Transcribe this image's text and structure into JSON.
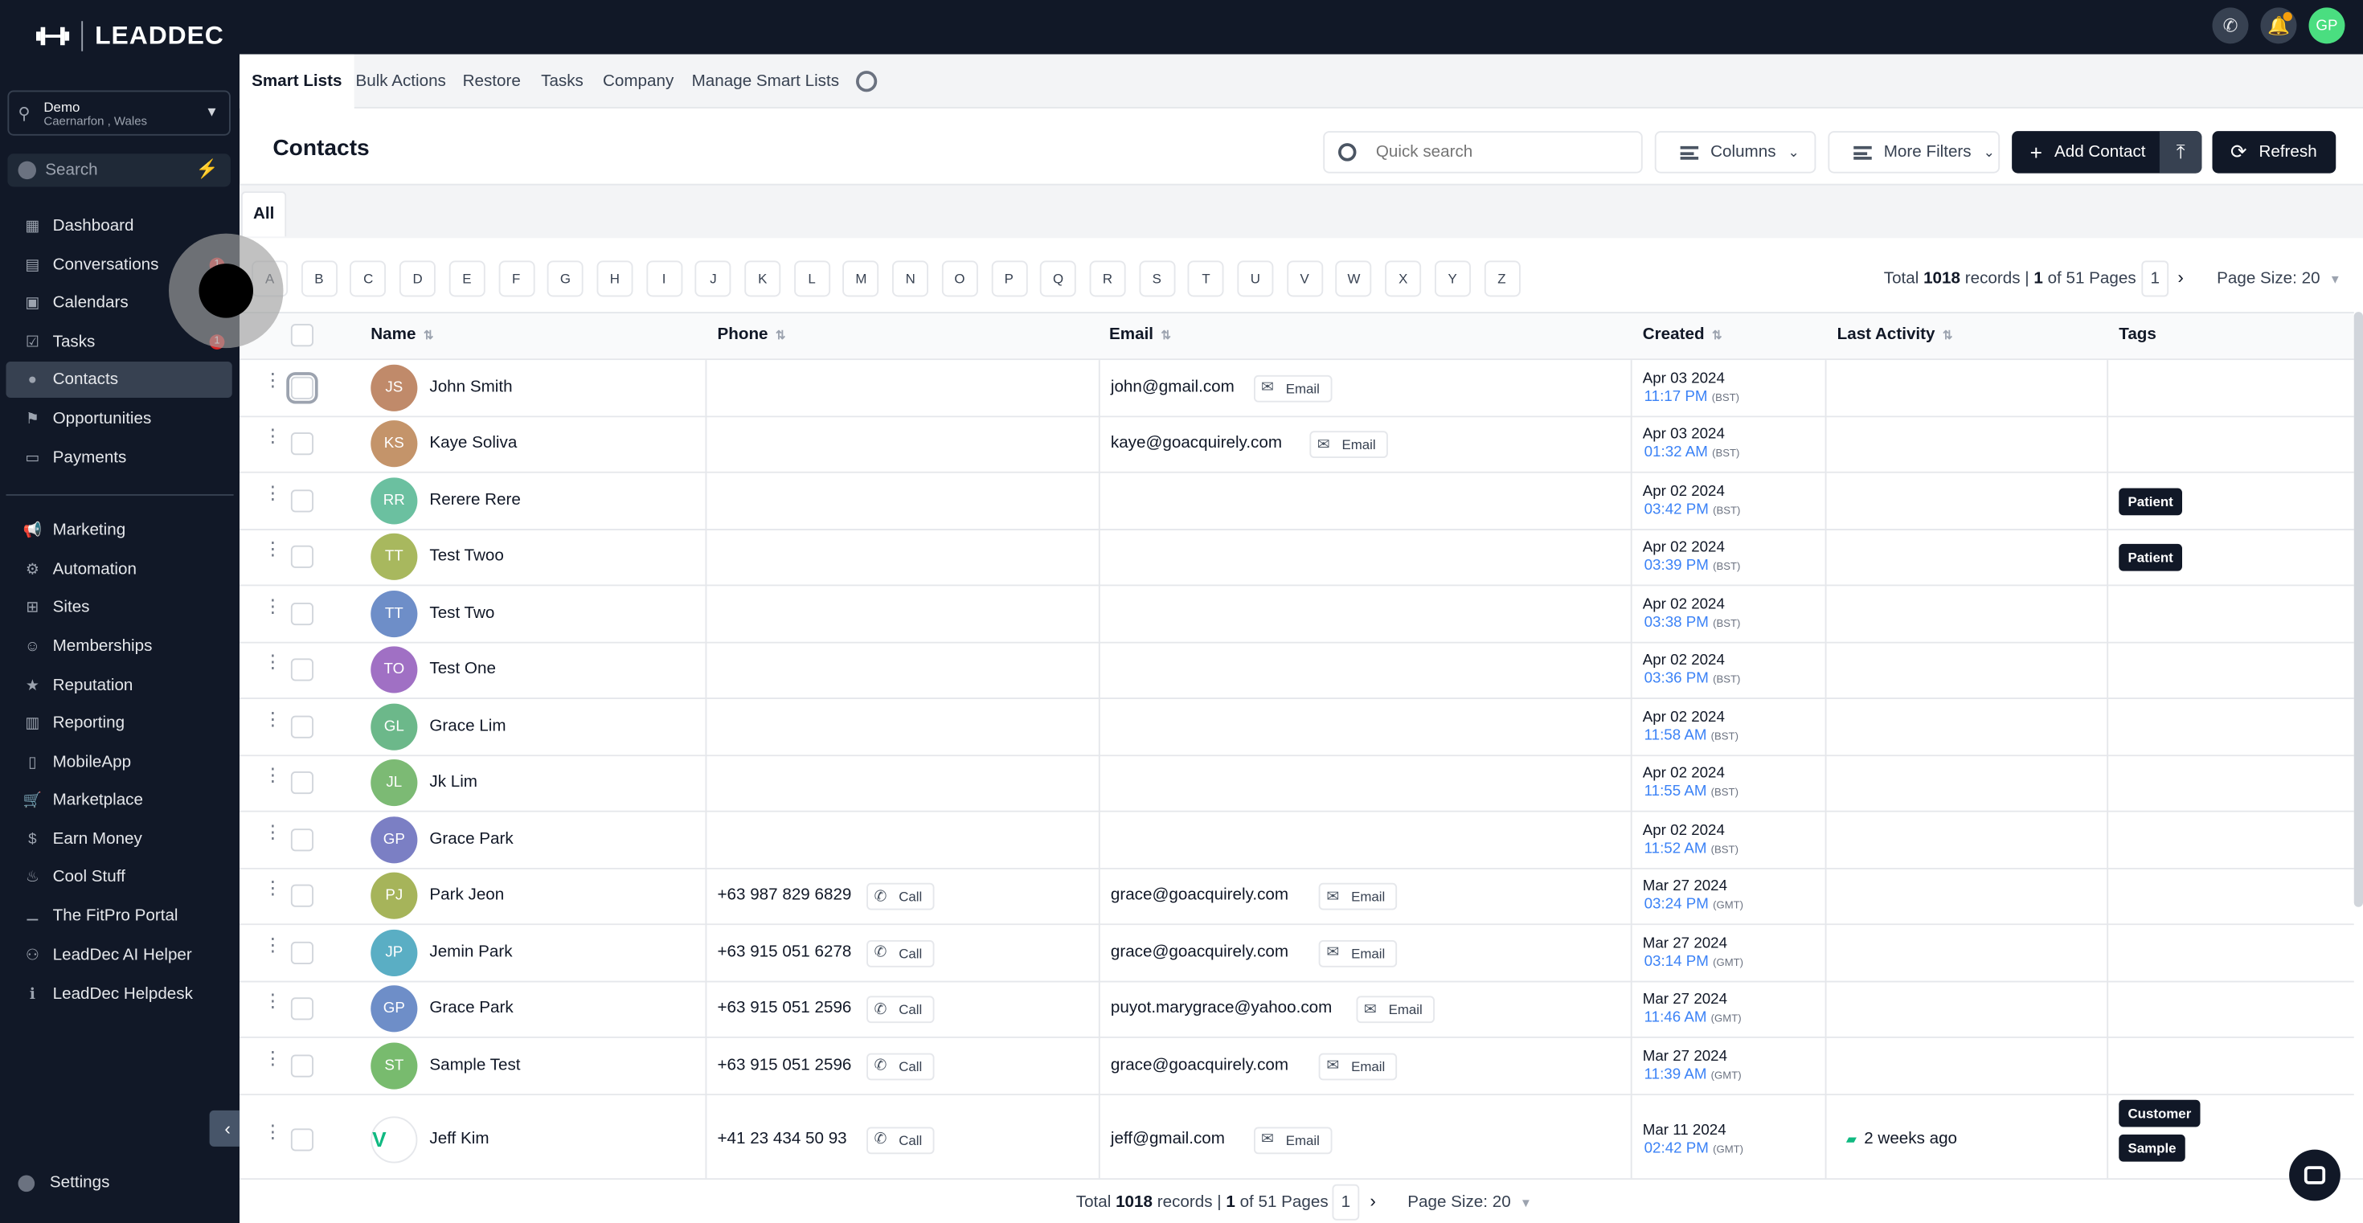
{
  "brand": {
    "name": "LEADDEC"
  },
  "topbar": {
    "avatar_initials": "GP",
    "phone_icon": "phone-icon",
    "bell_icon": "bell-icon"
  },
  "location": {
    "name": "Demo",
    "address": "Caernarfon , Wales"
  },
  "sidebar": {
    "search_placeholder": "Search",
    "items": [
      {
        "label": "Dashboard",
        "icon": "dashboard-icon"
      },
      {
        "label": "Conversations",
        "icon": "chat-icon",
        "badge": "1"
      },
      {
        "label": "Calendars",
        "icon": "calendar-icon"
      },
      {
        "label": "Tasks",
        "icon": "tasks-icon",
        "badge": "1"
      },
      {
        "label": "Contacts",
        "icon": "user-icon",
        "active": true
      },
      {
        "label": "Opportunities",
        "icon": "funnel-icon"
      },
      {
        "label": "Payments",
        "icon": "payments-icon"
      },
      {
        "label": "Marketing",
        "icon": "megaphone-icon"
      },
      {
        "label": "Automation",
        "icon": "automation-icon"
      },
      {
        "label": "Sites",
        "icon": "sites-icon"
      },
      {
        "label": "Memberships",
        "icon": "members-icon"
      },
      {
        "label": "Reputation",
        "icon": "reputation-icon"
      },
      {
        "label": "Reporting",
        "icon": "reporting-icon"
      },
      {
        "label": "MobileApp",
        "icon": "mobile-icon"
      },
      {
        "label": "Marketplace",
        "icon": "cart-icon"
      },
      {
        "label": "Earn Money",
        "icon": "money-icon"
      },
      {
        "label": "Cool Stuff",
        "icon": "fire-icon"
      },
      {
        "label": "The FitPro Portal",
        "icon": "dumbbell-icon"
      },
      {
        "label": "LeadDec AI Helper",
        "icon": "robot-icon"
      },
      {
        "label": "LeadDec Helpdesk",
        "icon": "info-icon"
      }
    ],
    "settings_label": "Settings"
  },
  "tabs": [
    "Smart Lists",
    "Bulk Actions",
    "Restore",
    "Tasks",
    "Company",
    "Manage Smart Lists"
  ],
  "page": {
    "title": "Contacts",
    "search_placeholder": "Quick search",
    "columns_label": "Columns",
    "more_filters_label": "More Filters",
    "add_contact_label": "Add Contact",
    "refresh_label": "Refresh",
    "all_tab": "All"
  },
  "alphabet": [
    "A",
    "B",
    "C",
    "D",
    "E",
    "F",
    "G",
    "H",
    "I",
    "J",
    "K",
    "L",
    "M",
    "N",
    "O",
    "P",
    "Q",
    "R",
    "S",
    "T",
    "U",
    "V",
    "W",
    "X",
    "Y",
    "Z"
  ],
  "pagination": {
    "total_prefix": "Total",
    "total": "1018",
    "records_label": "records |",
    "current": "1",
    "of_label": "of 51 Pages",
    "page": "1",
    "page_size": "Page Size: 20"
  },
  "table": {
    "headers": [
      "Name",
      "Phone",
      "Email",
      "Created",
      "Last Activity",
      "Tags"
    ],
    "call_label": "Call",
    "email_label": "Email",
    "rows": [
      {
        "initials": "JS",
        "name": "John Smith",
        "phone": "",
        "email": "john@gmail.com",
        "date": "Apr 03 2024",
        "time": "11:17 PM",
        "tz": "(BST)",
        "tags": [],
        "color": "#c08a6a"
      },
      {
        "initials": "KS",
        "name": "Kaye Soliva",
        "phone": "",
        "email": "kaye@goacquirely.com",
        "date": "Apr 03 2024",
        "time": "01:32 AM",
        "tz": "(BST)",
        "tags": [],
        "color": "#c4946a"
      },
      {
        "initials": "RR",
        "name": "Rerere Rere",
        "phone": "",
        "email": "",
        "date": "Apr 02 2024",
        "time": "03:42 PM",
        "tz": "(BST)",
        "tags": [
          "Patient"
        ],
        "color": "#6bc0a0"
      },
      {
        "initials": "TT",
        "name": "Test Twoo",
        "phone": "",
        "email": "",
        "date": "Apr 02 2024",
        "time": "03:39 PM",
        "tz": "(BST)",
        "tags": [
          "Patient"
        ],
        "color": "#a8b85e"
      },
      {
        "initials": "TT",
        "name": "Test Two",
        "phone": "",
        "email": "",
        "date": "Apr 02 2024",
        "time": "03:38 PM",
        "tz": "(BST)",
        "tags": [],
        "color": "#6e8ec8"
      },
      {
        "initials": "TO",
        "name": "Test One",
        "phone": "",
        "email": "",
        "date": "Apr 02 2024",
        "time": "03:36 PM",
        "tz": "(BST)",
        "tags": [],
        "color": "#a070c4"
      },
      {
        "initials": "GL",
        "name": "Grace Lim",
        "phone": "",
        "email": "",
        "date": "Apr 02 2024",
        "time": "11:58 AM",
        "tz": "(BST)",
        "tags": [],
        "color": "#6cb88a"
      },
      {
        "initials": "JL",
        "name": "Jk Lim",
        "phone": "",
        "email": "",
        "date": "Apr 02 2024",
        "time": "11:55 AM",
        "tz": "(BST)",
        "tags": [],
        "color": "#7cba74"
      },
      {
        "initials": "GP",
        "name": "Grace Park",
        "phone": "",
        "email": "",
        "date": "Apr 02 2024",
        "time": "11:52 AM",
        "tz": "(BST)",
        "tags": [],
        "color": "#7b7fc4"
      },
      {
        "initials": "PJ",
        "name": "Park Jeon",
        "phone": "+63 987 829 6829",
        "email": "grace@goacquirely.com",
        "date": "Mar 27 2024",
        "time": "03:24 PM",
        "tz": "(GMT)",
        "tags": [],
        "color": "#a6b45a"
      },
      {
        "initials": "JP",
        "name": "Jemin Park",
        "phone": "+63 915 051 6278",
        "email": "grace@goacquirely.com",
        "date": "Mar 27 2024",
        "time": "03:14 PM",
        "tz": "(GMT)",
        "tags": [],
        "color": "#5aaec4"
      },
      {
        "initials": "GP",
        "name": "Grace Park",
        "phone": "+63 915 051 2596",
        "email": "puyot.marygrace@yahoo.com",
        "date": "Mar 27 2024",
        "time": "11:46 AM",
        "tz": "(GMT)",
        "tags": [],
        "color": "#6e8ec8"
      },
      {
        "initials": "ST",
        "name": "Sample Test",
        "phone": "+63 915 051 2596",
        "email": "grace@goacquirely.com",
        "date": "Mar 27 2024",
        "time": "11:39 AM",
        "tz": "(GMT)",
        "tags": [],
        "color": "#78bb6e"
      },
      {
        "initials": "",
        "name": "Jeff Kim",
        "phone": "+41 23 434 50 93",
        "email": "jeff@gmail.com",
        "date": "Mar 11 2024",
        "time": "02:42 PM",
        "tz": "(GMT)",
        "tags": [
          "Customer",
          "Sample"
        ],
        "last_activity": "2 weeks ago",
        "color": "logo"
      }
    ]
  }
}
